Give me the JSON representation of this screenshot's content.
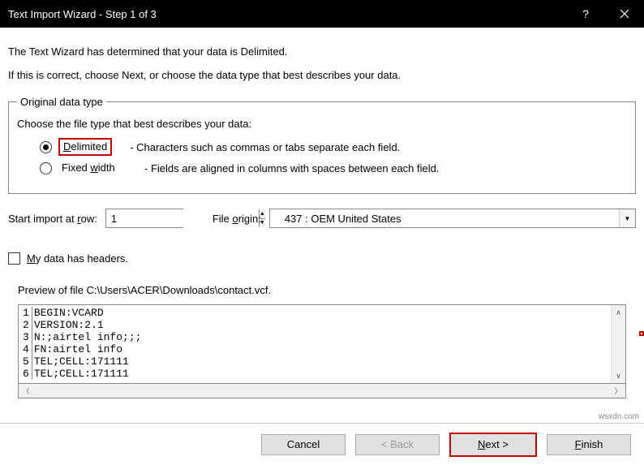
{
  "titlebar": {
    "title": "Text Import Wizard - Step 1 of 3"
  },
  "intro": {
    "line1": "The Text Wizard has determined that your data is Delimited.",
    "line2": "If this is correct, choose Next, or choose the data type that best describes your data."
  },
  "group": {
    "legend": "Original data type",
    "instruction": "Choose the file type that best describes your data:",
    "options": [
      {
        "label_pre": "",
        "label_ul": "D",
        "label_post": "elimited",
        "desc": "- Characters such as commas or tabs separate each field.",
        "selected": true
      },
      {
        "label_pre": "Fixed ",
        "label_ul": "w",
        "label_post": "idth",
        "desc": "- Fields are aligned in columns with spaces between each field.",
        "selected": false
      }
    ]
  },
  "start_row": {
    "label_pre": "Start import at ",
    "label_ul": "r",
    "label_post": "ow:",
    "value": "1"
  },
  "origin": {
    "label_pre": "File ",
    "label_ul": "o",
    "label_post": "rigin:",
    "value": "437 : OEM United States"
  },
  "headers_cb": {
    "label_ul": "M",
    "label_post": "y data has headers."
  },
  "preview": {
    "label": "Preview of file C:\\Users\\ACER\\Downloads\\contact.vcf.",
    "lines": [
      {
        "n": "1",
        "t": "BEGIN:VCARD"
      },
      {
        "n": "2",
        "t": "VERSION:2.1"
      },
      {
        "n": "3",
        "t": "N:;airtel info;;;"
      },
      {
        "n": "4",
        "t": "FN:airtel info"
      },
      {
        "n": "5",
        "t": "TEL;CELL:171111"
      },
      {
        "n": "6",
        "t": "TEL;CELL:171111"
      }
    ]
  },
  "buttons": {
    "cancel": "Cancel",
    "back": "< Back",
    "next_ul": "N",
    "next_post": "ext >",
    "finish_ul": "F",
    "finish_post": "inish"
  },
  "watermark": "wsxdn.com"
}
